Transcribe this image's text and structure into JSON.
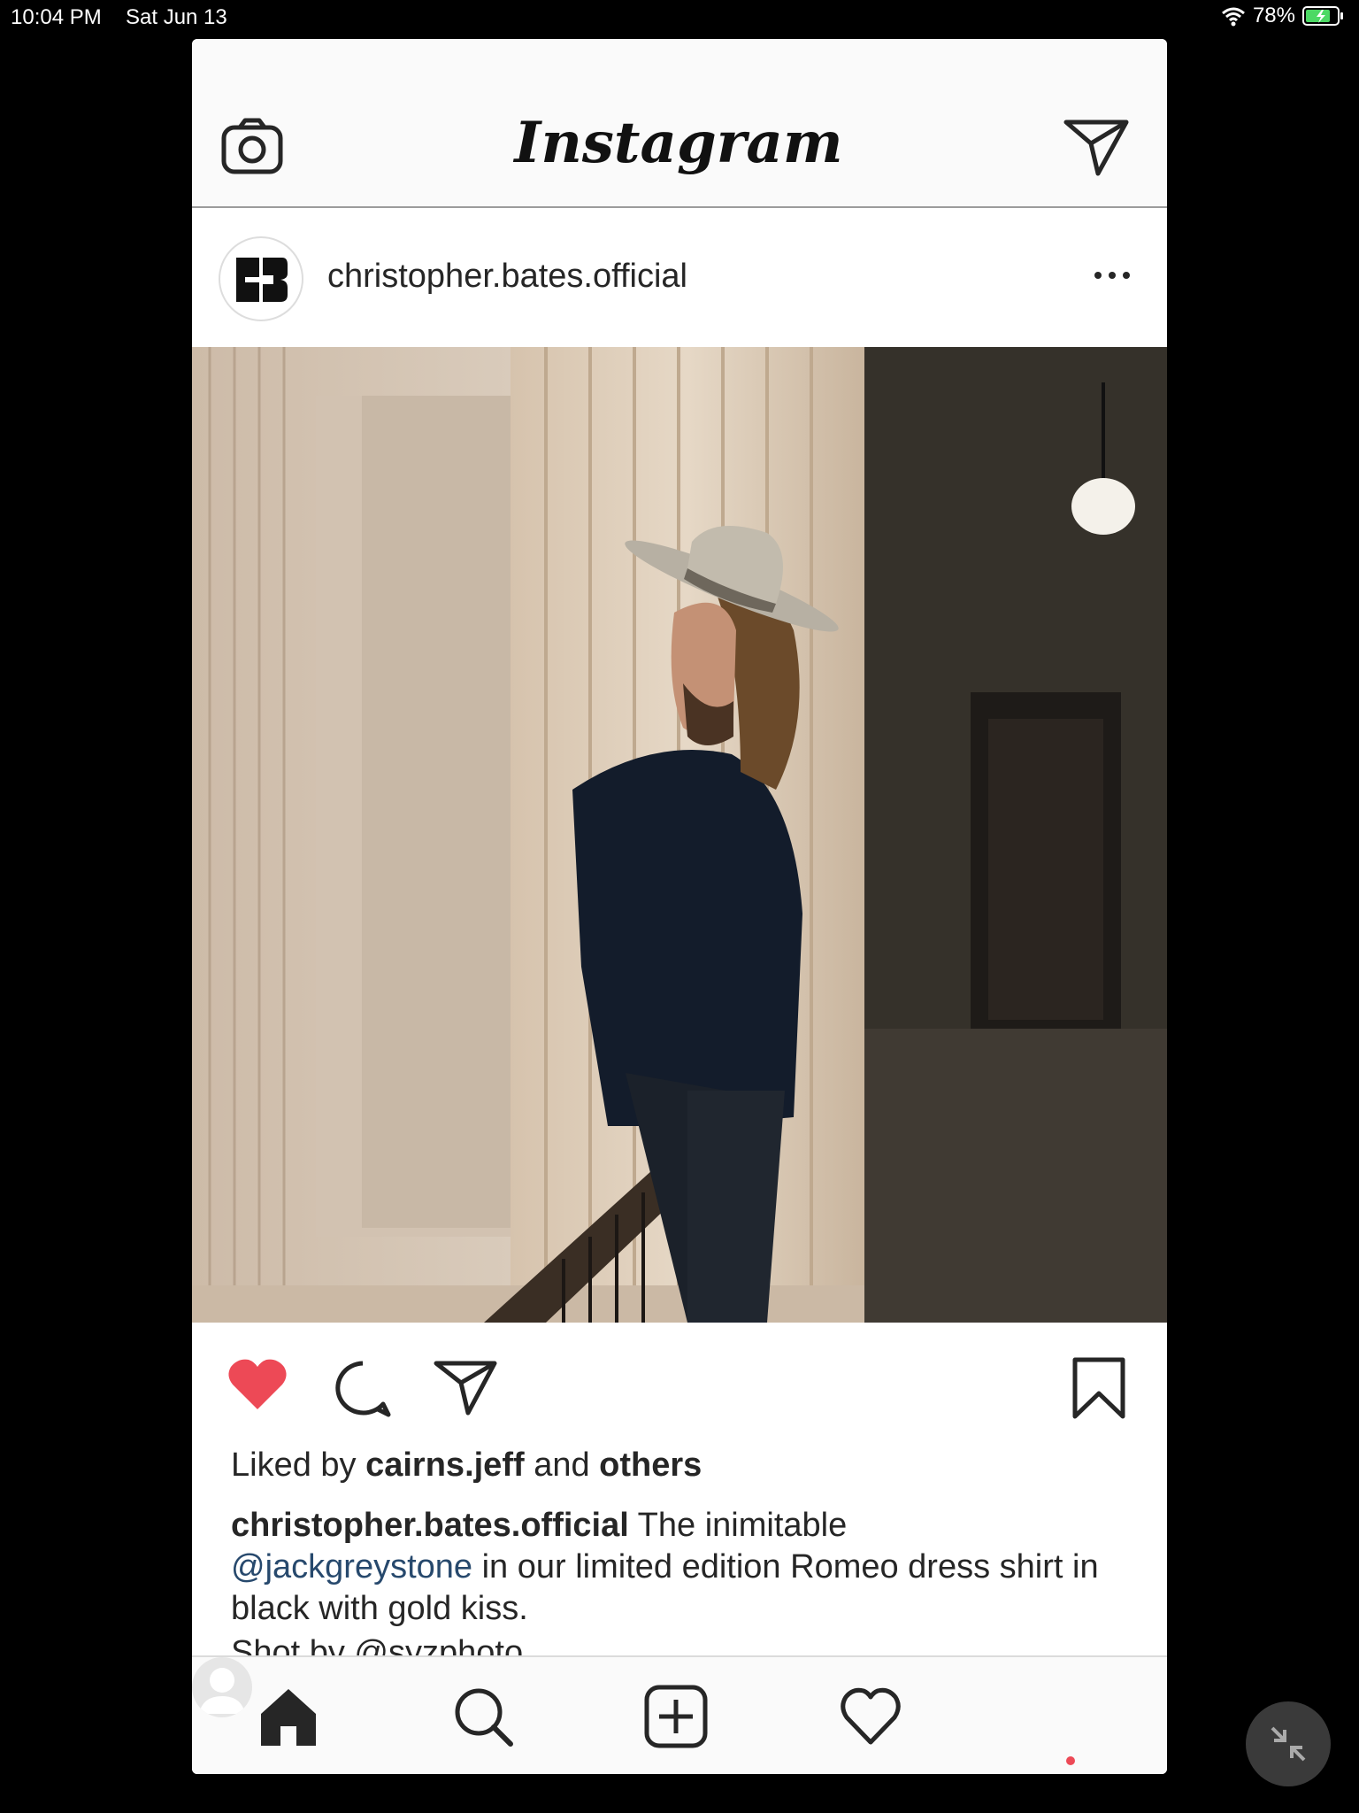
{
  "status_bar": {
    "time": "10:04 PM",
    "date": "Sat Jun 13",
    "battery": "78%"
  },
  "header": {
    "logo": "Instagram",
    "camera_icon": "camera-icon",
    "direct_icon": "paper-plane-icon"
  },
  "post": {
    "username": "christopher.bates.official",
    "likes": {
      "prefix": "Liked by",
      "user": "cairns.jeff",
      "connector": "and",
      "others": "others"
    },
    "caption": {
      "username": "christopher.bates.official",
      "text1": "The inimitable",
      "mention": "@jackgreystone",
      "text2": "in our limited edition Romeo dress shirt in black with gold kiss.",
      "cut_line": "Shot by @syzphoto"
    },
    "liked": true
  },
  "colors": {
    "like": "#ed4956",
    "mention": "#27496d",
    "text": "#262626"
  },
  "tabs": [
    "home-icon",
    "search-icon",
    "new-post-icon",
    "activity-icon",
    "profile-icon"
  ]
}
